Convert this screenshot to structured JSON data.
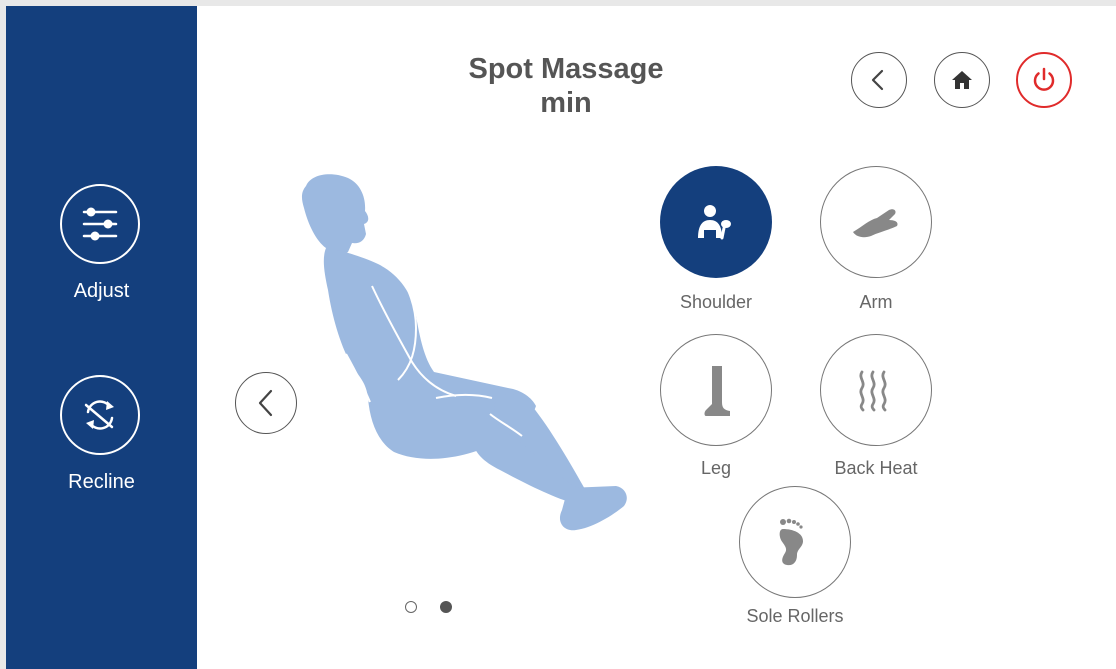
{
  "title": {
    "line1": "Spot Massage",
    "line2": "min"
  },
  "sidebar": {
    "items": [
      {
        "label": "Adjust",
        "icon": "sliders-icon"
      },
      {
        "label": "Recline",
        "icon": "recline-icon"
      }
    ]
  },
  "topbar": {
    "icons": [
      "back-icon",
      "home-icon",
      "power-icon"
    ]
  },
  "carousel": {
    "pages": 2,
    "current_page": 2
  },
  "zones": [
    {
      "label": "Shoulder",
      "icon": "shoulder-icon",
      "selected": true
    },
    {
      "label": "Arm",
      "icon": "arm-icon",
      "selected": false
    },
    {
      "label": "Leg",
      "icon": "leg-icon",
      "selected": false
    },
    {
      "label": "Back Heat",
      "icon": "heat-icon",
      "selected": false
    },
    {
      "label": "Sole Rollers",
      "icon": "foot-icon",
      "selected": false
    }
  ],
  "colors": {
    "sidebar": "#143f7d",
    "accent": "#143f7d",
    "power": "#e02b2b",
    "figure": "#9cb9e0",
    "text": "#555555"
  }
}
